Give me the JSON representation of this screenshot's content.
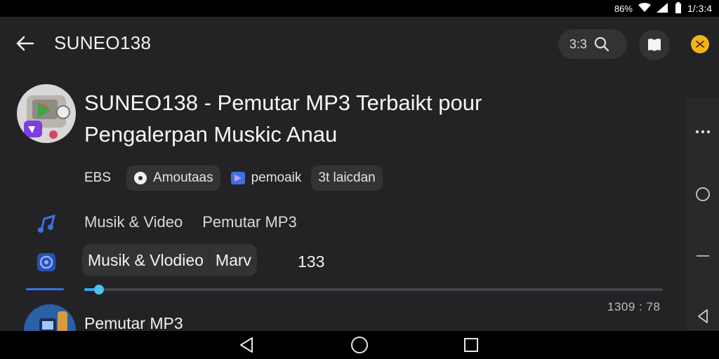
{
  "status_bar": {
    "signal_text": "86%",
    "time": "1/:3:4"
  },
  "topbar": {
    "title": "SUNEO138",
    "search_count": "3:3"
  },
  "headline": "SUNEO138 - Pemutar MP3 Terbaikt pour Pengalerpan Muskic Anau",
  "chips": {
    "lead_text": "EBS",
    "chip1_label": "Amoutaas",
    "chip2_label": "pemoaik",
    "chip3_label": "3t laicdan"
  },
  "categories": {
    "item1": "Musik & Video",
    "item2": "Pemutar MP3"
  },
  "segment": {
    "item1": "Musik &  Vlodieo",
    "item2": "Marv",
    "count": "133"
  },
  "progress": {
    "fraction": 0.026
  },
  "list_item": {
    "title": "Pemutar MP3",
    "time": "1309 : 78"
  },
  "colors": {
    "accent_blue": "#3d6fe6",
    "progress_blue": "#35a8e6",
    "profile_yellow": "#f2b517"
  },
  "icons": {
    "back": "arrow-left-icon",
    "search": "search-icon",
    "book": "book-icon",
    "profile": "profile-icon",
    "music": "music-note-icon",
    "at": "at-sign-icon"
  }
}
